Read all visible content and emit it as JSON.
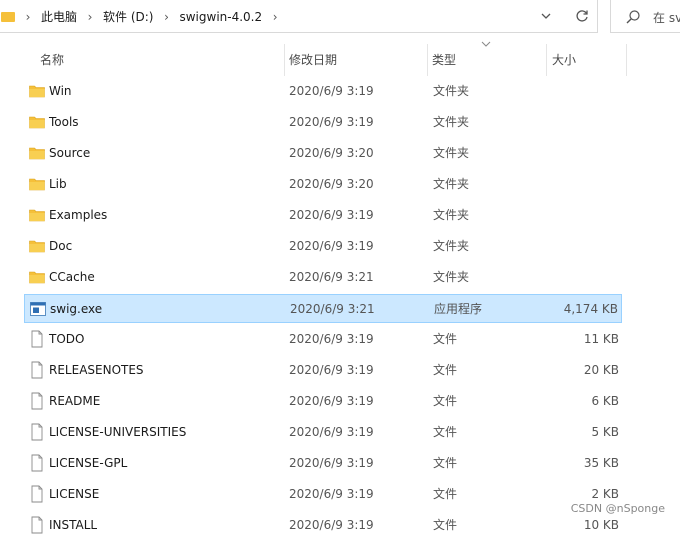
{
  "address": {
    "crumbs": [
      "此电脑",
      "软件 (D:)",
      "swigwin-4.0.2"
    ],
    "search_placeholder": "在 sv"
  },
  "columns": {
    "name": "名称",
    "date": "修改日期",
    "type": "类型",
    "size": "大小"
  },
  "files": [
    {
      "name": "Win",
      "date": "2020/6/9 3:19",
      "type": "文件夹",
      "size": "",
      "icon": "folder-icon"
    },
    {
      "name": "Tools",
      "date": "2020/6/9 3:19",
      "type": "文件夹",
      "size": "",
      "icon": "folder-icon"
    },
    {
      "name": "Source",
      "date": "2020/6/9 3:20",
      "type": "文件夹",
      "size": "",
      "icon": "folder-icon"
    },
    {
      "name": "Lib",
      "date": "2020/6/9 3:20",
      "type": "文件夹",
      "size": "",
      "icon": "folder-icon"
    },
    {
      "name": "Examples",
      "date": "2020/6/9 3:19",
      "type": "文件夹",
      "size": "",
      "icon": "folder-icon"
    },
    {
      "name": "Doc",
      "date": "2020/6/9 3:19",
      "type": "文件夹",
      "size": "",
      "icon": "folder-icon"
    },
    {
      "name": "CCache",
      "date": "2020/6/9 3:21",
      "type": "文件夹",
      "size": "",
      "icon": "folder-icon"
    },
    {
      "name": "swig.exe",
      "date": "2020/6/9 3:21",
      "type": "应用程序",
      "size": "4,174 KB",
      "icon": "exe-icon",
      "selected": true
    },
    {
      "name": "TODO",
      "date": "2020/6/9 3:19",
      "type": "文件",
      "size": "11 KB",
      "icon": "file-icon"
    },
    {
      "name": "RELEASENOTES",
      "date": "2020/6/9 3:19",
      "type": "文件",
      "size": "20 KB",
      "icon": "file-icon"
    },
    {
      "name": "README",
      "date": "2020/6/9 3:19",
      "type": "文件",
      "size": "6 KB",
      "icon": "file-icon"
    },
    {
      "name": "LICENSE-UNIVERSITIES",
      "date": "2020/6/9 3:19",
      "type": "文件",
      "size": "5 KB",
      "icon": "file-icon"
    },
    {
      "name": "LICENSE-GPL",
      "date": "2020/6/9 3:19",
      "type": "文件",
      "size": "35 KB",
      "icon": "file-icon"
    },
    {
      "name": "LICENSE",
      "date": "2020/6/9 3:19",
      "type": "文件",
      "size": "2 KB",
      "icon": "file-icon"
    },
    {
      "name": "INSTALL",
      "date": "2020/6/9 3:19",
      "type": "文件",
      "size": "10 KB",
      "icon": "file-icon"
    }
  ],
  "watermark": "CSDN @nSponge",
  "colors": {
    "folder": "#f5c03a",
    "selected_bg": "#cce8ff",
    "selected_border": "#99d1ff"
  }
}
